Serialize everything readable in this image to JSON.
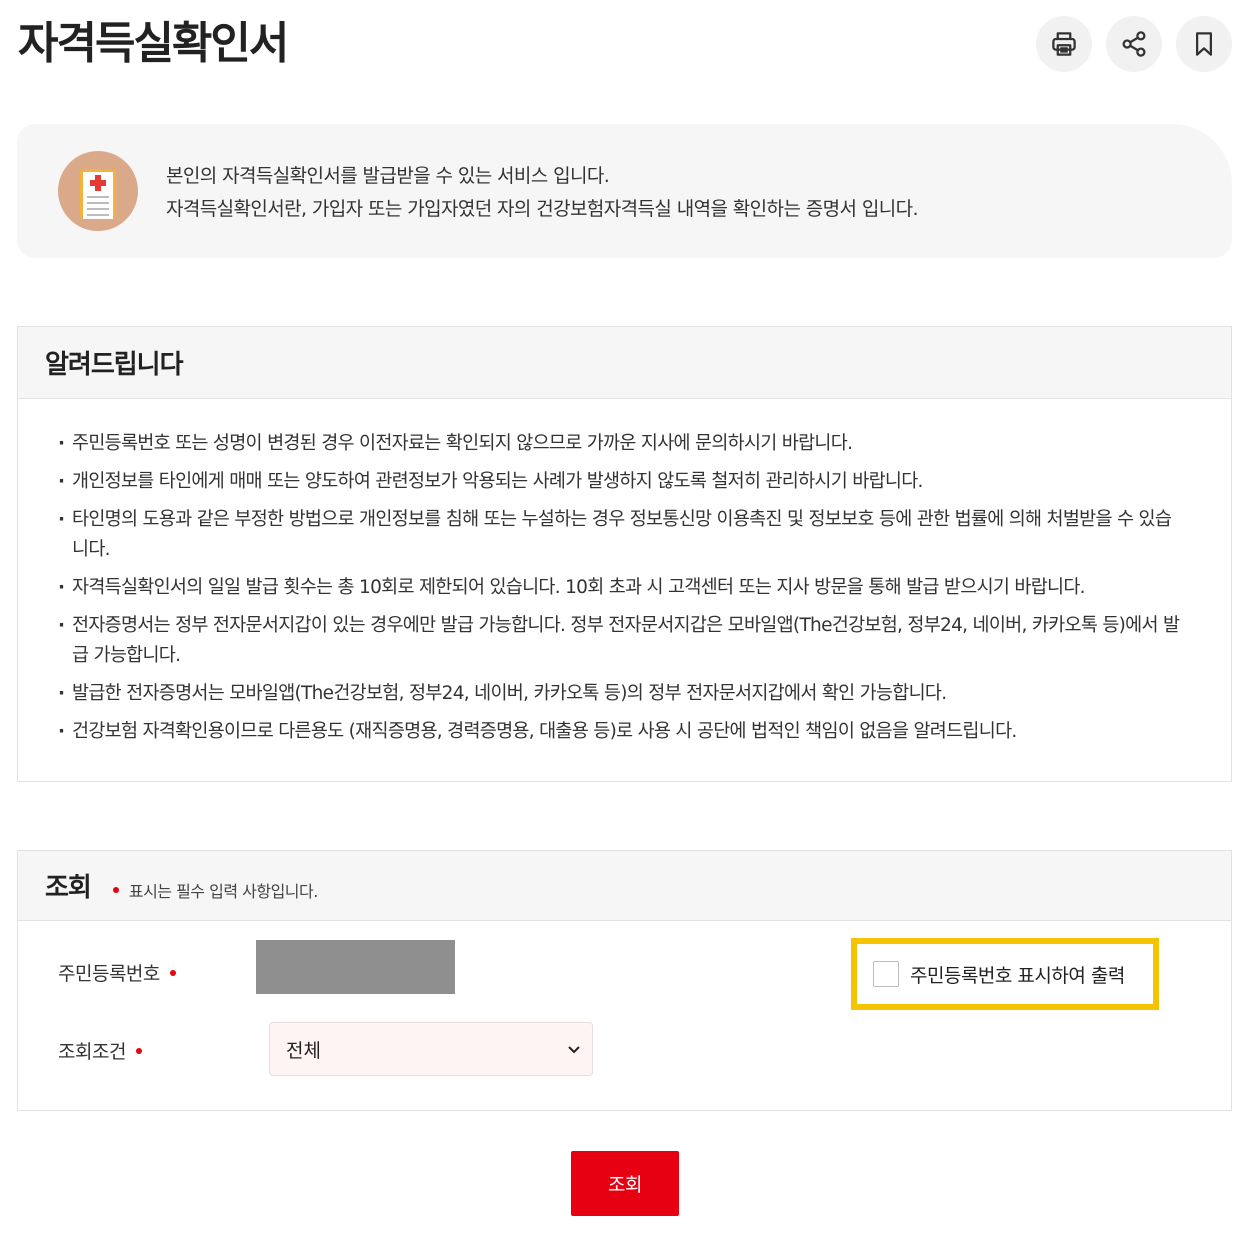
{
  "page": {
    "title": "자격득실확인서"
  },
  "toolbar": {
    "print_icon": "printer-icon",
    "share_icon": "share-icon",
    "bookmark_icon": "bookmark-icon"
  },
  "intro": {
    "icon": "document-medical-icon",
    "line1": "본인의 자격득실확인서를 발급받을 수 있는 서비스 입니다.",
    "line2": "자격득실확인서란, 가입자 또는 가입자였던 자의 건강보험자격득실 내역을 확인하는 증명서 입니다."
  },
  "notice": {
    "title": "알려드립니다",
    "items": [
      "주민등록번호 또는 성명이 변경된 경우 이전자료는 확인되지 않으므로 가까운 지사에 문의하시기 바랍니다.",
      "개인정보를 타인에게 매매 또는 양도하여 관련정보가 악용되는 사례가 발생하지 않도록 철저히 관리하시기 바랍니다.",
      "타인명의 도용과 같은 부정한 방법으로 개인정보를 침해 또는 누설하는 경우 정보통신망 이용촉진 및 정보보호 등에 관한 법률에 의해 처벌받을 수 있습니다.",
      "자격득실확인서의 일일 발급 횟수는 총 10회로 제한되어 있습니다. 10회 초과 시 고객센터 또는 지사 방문을 통해 발급 받으시기 바랍니다.",
      "전자증명서는 정부 전자문서지갑이 있는 경우에만 발급 가능합니다. 정부 전자문서지갑은 모바일앱(The건강보험, 정부24, 네이버, 카카오톡 등)에서 발급 가능합니다.",
      "발급한 전자증명서는 모바일앱(The건강보험, 정부24, 네이버, 카카오톡 등)의 정부 전자문서지갑에서 확인 가능합니다.",
      "건강보험 자격확인용이므로 다른용도 (재직증명용, 경력증명용, 대출용 등)로 사용 시 공단에 법적인 책임이 없음을 알려드립니다."
    ]
  },
  "query": {
    "title": "조회",
    "required_note": "표시는 필수 입력 사항입니다.",
    "rrn_label": "주민등록번호",
    "show_rrn_label": "주민등록번호 표시하여 출력",
    "show_rrn_checked": false,
    "condition_label": "조회조건",
    "condition_value": "전체",
    "submit_label": "조회"
  },
  "colors": {
    "accent_red": "#e60012",
    "highlight_yellow": "#f5c400",
    "panel_gray": "#f6f6f6",
    "masked_gray": "#8f8f8f"
  }
}
